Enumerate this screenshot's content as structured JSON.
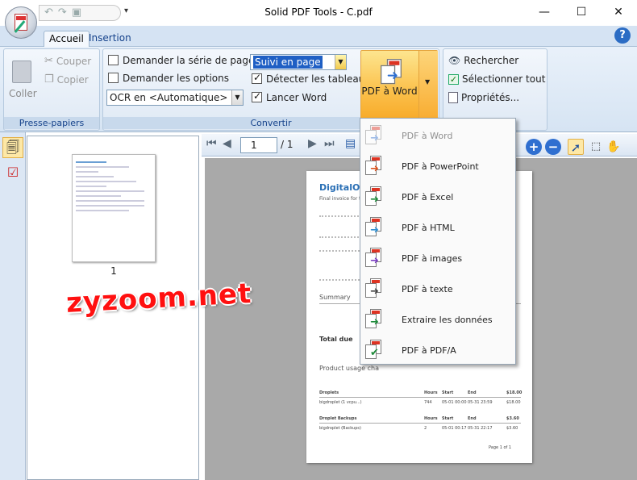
{
  "window": {
    "title": "Solid PDF Tools - C.pdf",
    "minimize": "—",
    "maximize": "☐",
    "close": "✕"
  },
  "qat": {
    "undo": "↶",
    "redo": "↷",
    "save": "▣",
    "menu": "▾"
  },
  "tabs": [
    {
      "label": "Accueil"
    },
    {
      "label": "Insertion"
    }
  ],
  "help": "?",
  "clipboard": {
    "paste": "Coller",
    "cut": "Couper",
    "copy": "Copier",
    "group_label": "Presse-papiers"
  },
  "convert": {
    "ask_page_series": "Demander la série de pages",
    "ask_options": "Demander les options",
    "layout_value": "Suivi en page",
    "detect_tables": "Détecter les tableaux",
    "ocr_value": "OCR en <Automatique>",
    "launch_word": "Lancer Word",
    "pdf_to_word": "PDF à Word",
    "group_label": "Convertir"
  },
  "edit": {
    "search": "Rechercher",
    "select_all": "Sélectionner tout",
    "properties": "Propriétés..."
  },
  "viewer": {
    "current_page": "1",
    "page_total": "/ 1",
    "thumb_number": "1"
  },
  "watermark": "zyzoom.net",
  "menu": {
    "items": [
      {
        "label": "PDF à Word",
        "color": "#2f6fd0"
      },
      {
        "label": "PDF à PowerPoint",
        "color": "#d9531e"
      },
      {
        "label": "PDF à Excel",
        "color": "#1e8a3a"
      },
      {
        "label": "PDF à HTML",
        "color": "#2f8fd0"
      },
      {
        "label": "PDF à images",
        "color": "#7a3fc0"
      },
      {
        "label": "PDF à texte",
        "color": "#444444"
      },
      {
        "label": "Extraire les données",
        "color": "#1e8a3a"
      },
      {
        "label": "PDF à PDF/A",
        "color": "#1e8a3a"
      }
    ]
  },
  "document": {
    "brand": "DigitalO",
    "subtitle": "Final invoice for th",
    "summary": "Summary",
    "total_due": "Total due",
    "product_usage": "Product usage cha",
    "table1_header": [
      "Droplets",
      "Hours",
      "Start",
      "End",
      "$18.00"
    ],
    "table1_row": [
      "bigdroplet (1 vcpu...)",
      "744",
      "05-01 00:00",
      "05-31 23:59",
      "$18.00"
    ],
    "table2_header": [
      "Droplet Backups",
      "Hours",
      "Start",
      "End",
      "$3.60"
    ],
    "table2_row": [
      "bigdroplet (Backups)",
      "2",
      "05-01 00:17",
      "05-31 22:17",
      "$3.60"
    ],
    "page_footer": "Page 1 of 1"
  }
}
